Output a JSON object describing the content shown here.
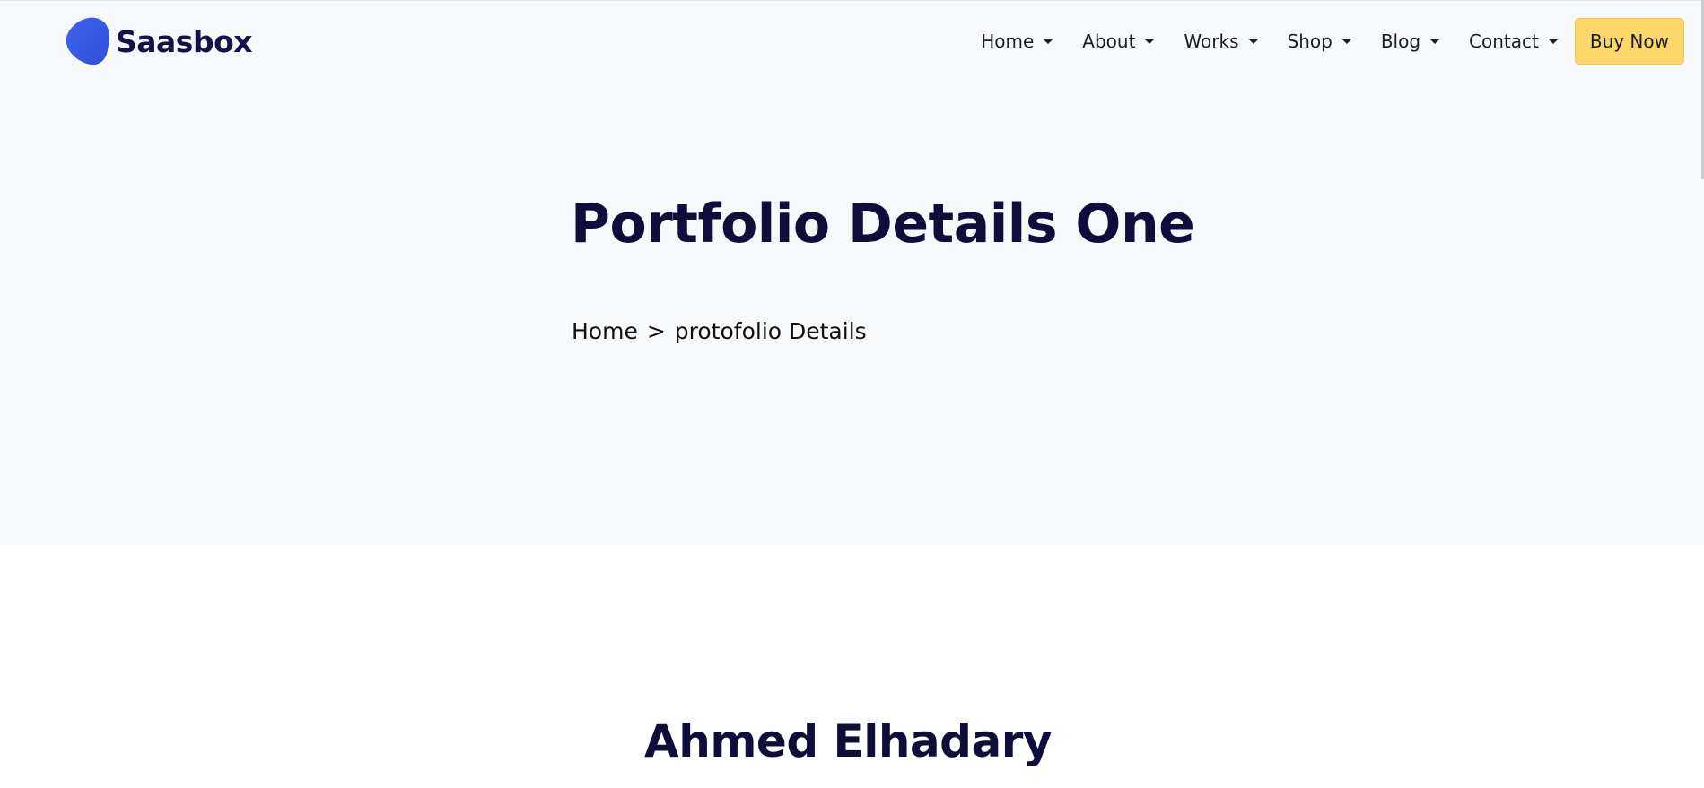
{
  "brand": {
    "name": "Saasbox",
    "logo_color": "#3d5be0"
  },
  "nav": {
    "items": [
      {
        "label": "Home"
      },
      {
        "label": "About"
      },
      {
        "label": "Works"
      },
      {
        "label": "Shop"
      },
      {
        "label": "Blog"
      },
      {
        "label": "Contact"
      }
    ],
    "cta_label": "Buy Now",
    "cta_color": "#fdd76a"
  },
  "hero": {
    "title": "Portfolio Details One",
    "breadcrumb": {
      "home": "Home",
      "separator": ">",
      "current": "protofolio Details"
    }
  },
  "content": {
    "heading": "Ahmed Elhadary"
  },
  "colors": {
    "hero_bg": "#f7f8fa",
    "heading": "#0f0e3b"
  }
}
